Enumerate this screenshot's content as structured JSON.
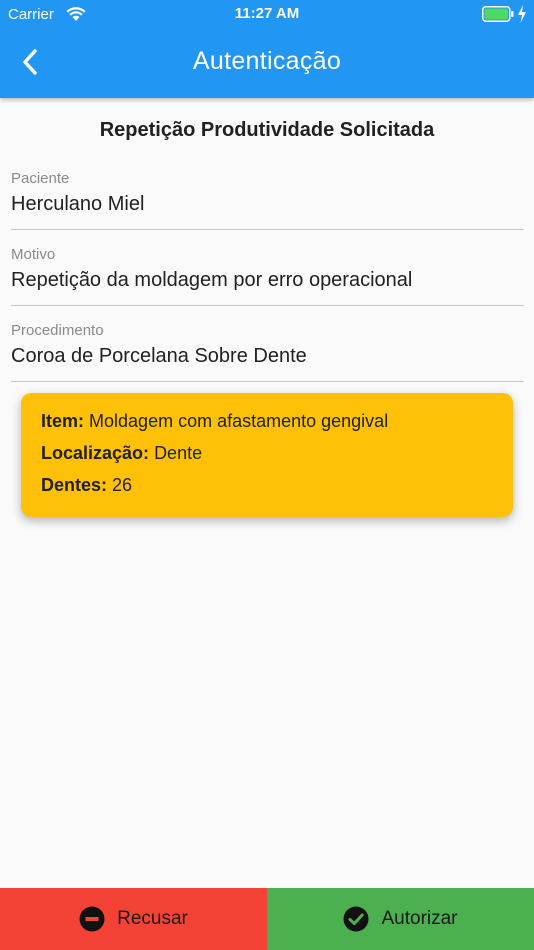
{
  "status_bar": {
    "carrier": "Carrier",
    "time": "11:27 AM"
  },
  "app_bar": {
    "title": "Autenticação",
    "back_icon": "chevron-left-icon"
  },
  "page": {
    "title": "Repetição Produtividade Solicitada",
    "fields": [
      {
        "label": "Paciente",
        "value": "Herculano Miel"
      },
      {
        "label": "Motivo",
        "value": "Repetição da moldagem por erro operacional"
      },
      {
        "label": "Procedimento",
        "value": "Coroa de Porcelana Sobre Dente"
      }
    ]
  },
  "card": {
    "color": "#ffc107",
    "lines": [
      {
        "label": "Item:",
        "value": "Moldagem com afastamento gengival"
      },
      {
        "label": "Localização:",
        "value": "Dente"
      },
      {
        "label": "Dentes:",
        "value": "26"
      }
    ]
  },
  "actions": {
    "refuse": {
      "label": "Recusar",
      "icon": "minus-circle-icon",
      "color": "#f44336"
    },
    "authorize": {
      "label": "Autorizar",
      "icon": "check-circle-icon",
      "color": "#4caf50"
    }
  },
  "colors": {
    "primary": "#2196f3",
    "background": "#fafafa"
  }
}
